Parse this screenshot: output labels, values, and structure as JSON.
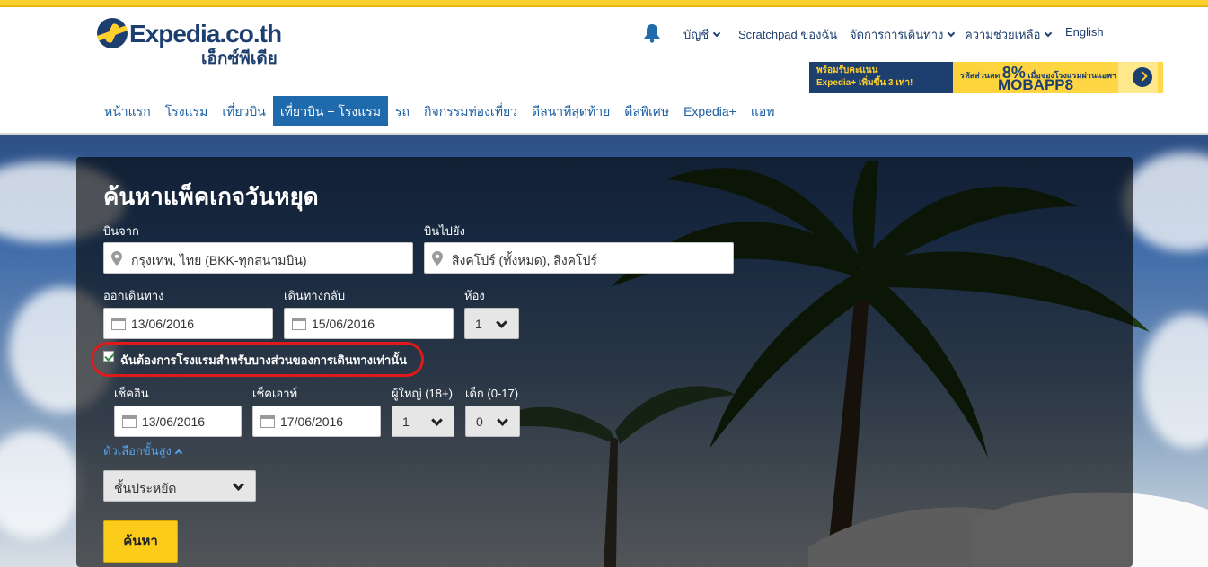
{
  "brand": {
    "logo_text": "Expedia.co.th",
    "logo_thai": "เอ็กซ์พีเดีย"
  },
  "utility_nav": {
    "account": "บัญชี",
    "scratchpad": "Scratchpad ของฉัน",
    "manage_trips": "จัดการการเดินทาง",
    "help": "ความช่วยเหลือ",
    "language": "English"
  },
  "promo": {
    "left_line1": "พร้อมรับคะแนน",
    "left_line2": "Expedia+ เพิ่มขึ้น 3 เท่า!",
    "mid_label": "รหัสส่วนลด",
    "percent": "8%",
    "mid_text": "เมื่อจองโรงแรมผ่านแอพฯ มือถือ",
    "code": "MOBAPP8"
  },
  "main_nav": [
    {
      "label": "หน้าแรก",
      "active": false
    },
    {
      "label": "โรงแรม",
      "active": false
    },
    {
      "label": "เที่ยวบิน",
      "active": false
    },
    {
      "label": "เที่ยวบิน + โรงแรม",
      "active": true
    },
    {
      "label": "รถ",
      "active": false
    },
    {
      "label": "กิจกรรมท่องเที่ยว",
      "active": false
    },
    {
      "label": "ดีลนาทีสุดท้าย",
      "active": false
    },
    {
      "label": "ดีลพิเศษ",
      "active": false
    },
    {
      "label": "Expedia+",
      "active": false
    },
    {
      "label": "แอพ",
      "active": false
    }
  ],
  "search_form": {
    "title": "ค้นหาแพ็คเกจวันหยุด",
    "from_label": "บินจาก",
    "from_value": "กรุงเทพ, ไทย (BKK-ทุกสนามบิน)",
    "to_label": "บินไปยัง",
    "to_value": "สิงคโปร์ (ทั้งหมด), สิงคโปร์",
    "depart_label": "ออกเดินทาง",
    "depart_value": "13/06/2016",
    "return_label": "เดินทางกลับ",
    "return_value": "15/06/2016",
    "rooms_label": "ห้อง",
    "rooms_value": "1",
    "partial_stay_label": "ฉันต้องการโรงแรมสำหรับบางส่วนของการเดินทางเท่านั้น",
    "partial_stay_checked": true,
    "checkin_label": "เช็คอิน",
    "checkin_value": "13/06/2016",
    "checkout_label": "เช็คเอาท์",
    "checkout_value": "17/06/2016",
    "adults_label": "ผู้ใหญ่ (18+)",
    "adults_value": "1",
    "children_label": "เด็ก (0-17)",
    "children_value": "0",
    "advanced_label": "ตัวเลือกขั้นสูง",
    "class_value": "ชั้นประหยัด",
    "search_button": "ค้นหา"
  },
  "colors": {
    "brand_yellow": "#fdd02e",
    "brand_navy": "#1d3f6f",
    "nav_active": "#1f6aad",
    "highlight_red": "#e01a1a"
  }
}
